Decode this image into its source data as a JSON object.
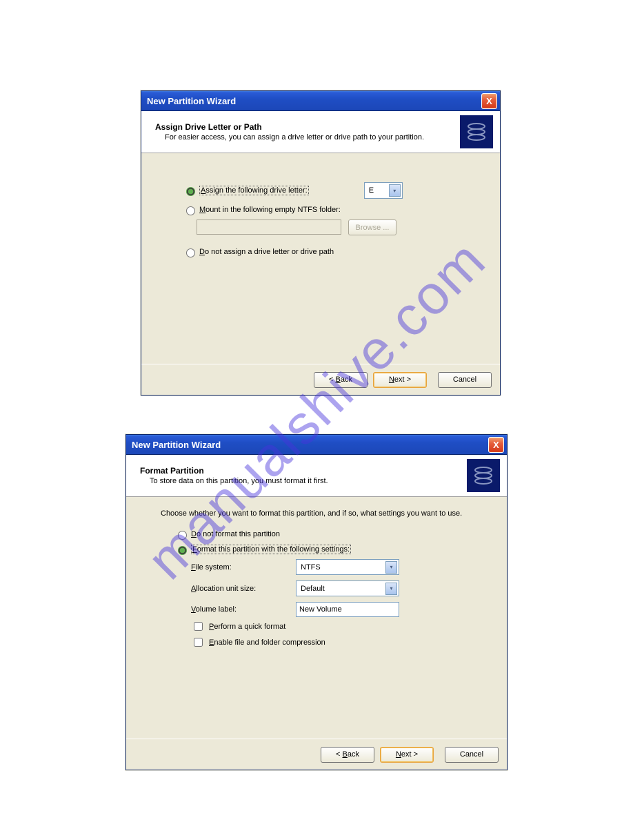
{
  "watermark": "manualshive.com",
  "d1": {
    "title": "New Partition Wizard",
    "close_x": "X",
    "header_title": "Assign Drive Letter or Path",
    "header_sub": "For easier access, you can assign a drive letter or drive path to your partition.",
    "radio_assign_prefix": "A",
    "radio_assign_text": "ssign the following drive letter:",
    "drive_letter": "E",
    "radio_mount_prefix": "M",
    "radio_mount_text": "ount in the following empty NTFS folder:",
    "browse_text": "Browse ...",
    "radio_none_prefix": "D",
    "radio_none_text": "o not assign a drive letter or drive path",
    "back_prefix": "< ",
    "back_u": "B",
    "back_suffix": "ack",
    "next_u": "N",
    "next_suffix": "ext >",
    "cancel": "Cancel"
  },
  "d2": {
    "title": "New Partition Wizard",
    "close_x": "X",
    "header_title": "Format Partition",
    "header_sub": "To store data on this partition, you must format it first.",
    "instruction": "Choose whether you want to format this partition, and if so, what settings you want to use.",
    "radio_noformat_prefix": "D",
    "radio_noformat_text": "o not format this partition",
    "radio_format_prefix": "F",
    "radio_format_text": "ormat this partition with the following settings:",
    "fs_label_prefix": "F",
    "fs_label_suffix": "ile system:",
    "fs_value": "NTFS",
    "au_label_prefix": "A",
    "au_label_suffix": "llocation unit size:",
    "au_value": "Default",
    "vl_label_prefix": "V",
    "vl_label_suffix": "olume label:",
    "vl_value": "New Volume",
    "quick_prefix": "P",
    "quick_suffix": "erform a quick format",
    "comp_prefix": "E",
    "comp_suffix": "nable file and folder compression",
    "back_prefix": "< ",
    "back_u": "B",
    "back_suffix": "ack",
    "next_u": "N",
    "next_suffix": "ext >",
    "cancel": "Cancel"
  }
}
